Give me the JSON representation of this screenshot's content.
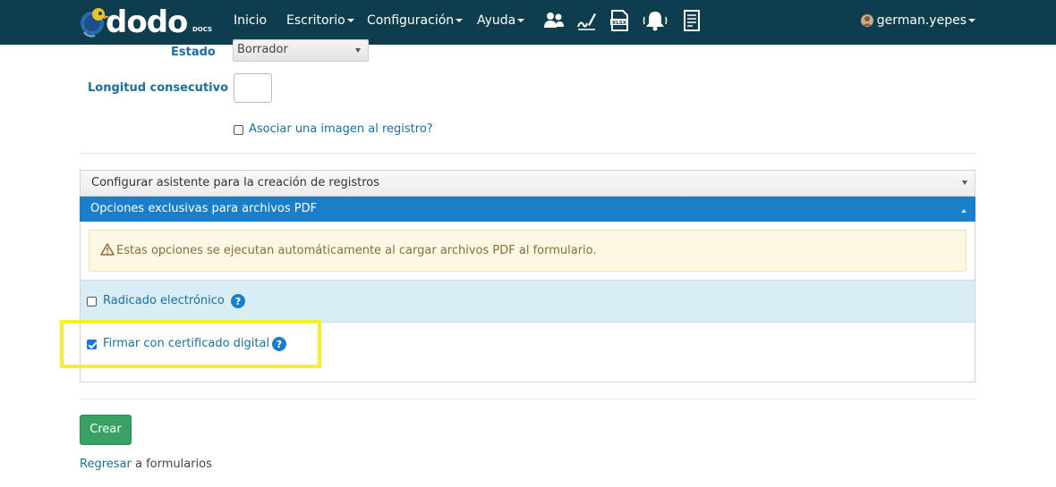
{
  "navbar": {
    "brand": "dodo",
    "brand_sub": "DOCS",
    "menu": [
      {
        "label": "Inicio"
      },
      {
        "label": "Escritorio"
      },
      {
        "label": "Configuración"
      },
      {
        "label": "Ayuda"
      }
    ],
    "icons": [
      "users-icon",
      "signature-icon",
      "xlsx-icon",
      "bell-icon",
      "document-list-icon"
    ],
    "user": "german.yepes"
  },
  "form": {
    "estado_label": "Estado",
    "estado_value": "Borrador",
    "longitud_label": "Longitud consecutivo",
    "longitud_value": "",
    "asociar_imagen_label": "Asociar una imagen al registro?",
    "asociar_imagen_checked": false
  },
  "accordion": {
    "section1_title": "Configurar asistente para la creación de registros",
    "section2_title": "Opciones exclusivas para archivos PDF",
    "alert_text": "Estas opciones se ejecutan automáticamente al cargar archivos PDF al formulario.",
    "radicado_label": "Radicado electrónico",
    "radicado_checked": false,
    "firmar_label": "Firmar con certificado digital",
    "firmar_checked": true
  },
  "actions": {
    "create_label": "Crear",
    "back_link": "Regresar",
    "back_rest": "a formularios"
  },
  "colors": {
    "navbar_bg": "#0e3d4d",
    "accent_blue": "#1a7fc8",
    "link_blue": "#1a6fa0",
    "create_green": "#3aa164",
    "highlight_yellow": "#f5f02a"
  }
}
